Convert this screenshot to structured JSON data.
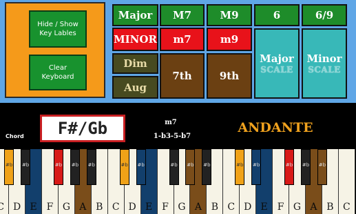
{
  "controls": {
    "hide_show": "Hide / Show Key Lables",
    "clear": "Clear Keyboard"
  },
  "chord_buttons": {
    "major": "Major",
    "m7_upper": "M7",
    "m9_upper": "M9",
    "six": "6",
    "six_nine": "6/9",
    "minor": "MINOR",
    "m7": "m7",
    "m9": "m9",
    "dim": "Dim",
    "aug": "Aug",
    "seventh": "7th",
    "ninth": "9th",
    "major_scale_top": "Major",
    "major_scale_sub": "SCALE",
    "minor_scale_top": "Minor",
    "minor_scale_sub": "SCALE"
  },
  "info": {
    "chord_label": "Chord",
    "chord_name": "F#/Gb",
    "chord_type": "m7",
    "formula": "1-b3-5-b7",
    "tempo": "ANDANTE"
  },
  "keyboard": {
    "white_keys": [
      "C",
      "D",
      "E",
      "F",
      "G",
      "A",
      "B",
      "C",
      "D",
      "E",
      "F",
      "G",
      "A",
      "B",
      "C",
      "D",
      "E",
      "F",
      "G",
      "A",
      "B",
      "C"
    ],
    "black_label": "#b",
    "colors": {
      "orange": "#f0a218",
      "red": "#d81a18",
      "blue": "#123f6c",
      "brown": "#7a4d1a"
    }
  }
}
